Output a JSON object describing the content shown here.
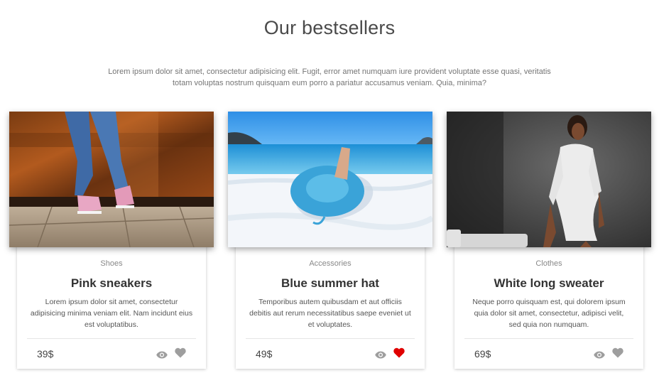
{
  "section": {
    "title": "Our bestsellers",
    "intro": "Lorem ipsum dolor sit amet, consectetur adipisicing elit. Fugit, error amet numquam iure provident voluptate esse quasi, veritatis totam voluptas nostrum quisquam eum porro a pariatur accusamus veniam. Quia, minima?"
  },
  "products": [
    {
      "category": "Shoes",
      "name": "Pink sneakers",
      "description": "Lorem ipsum dolor sit amet, consectetur adipisicing minima veniam elit. Nam incidunt eius est voluptatibus.",
      "price": "39$",
      "favorited": false
    },
    {
      "category": "Accessories",
      "name": "Blue summer hat",
      "description": "Temporibus autem quibusdam et aut officiis debitis aut rerum necessitatibus saepe eveniet ut et voluptates.",
      "price": "49$",
      "favorited": true
    },
    {
      "category": "Clothes",
      "name": "White long sweater",
      "description": "Neque porro quisquam est, qui dolorem ipsum quia dolor sit amet, consectetur, adipisci velit, sed quia non numquam.",
      "price": "69$",
      "favorited": false
    }
  ],
  "colors": {
    "heart_active": "#e00000",
    "heart_inactive": "#9e9e9e",
    "eye": "#9e9e9e"
  },
  "icons": {
    "view": "eye-icon",
    "favorite": "heart-icon"
  }
}
